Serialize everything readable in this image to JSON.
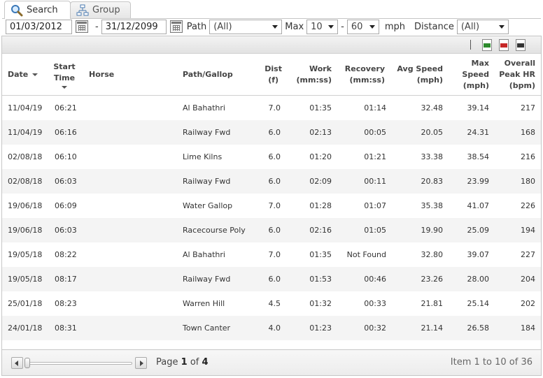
{
  "tabs": [
    {
      "label": "Search",
      "icon": "magnifier-icon",
      "active": true
    },
    {
      "label": "Group",
      "icon": "hierarchy-icon",
      "active": false
    }
  ],
  "filters": {
    "date_from": "01/03/2012",
    "date_sep": "-",
    "date_to": "31/12/2099",
    "path_label": "Path",
    "path_value": "(All)",
    "max_label": "Max",
    "speed_min": "10",
    "speed_sep": "-",
    "speed_max": "60",
    "speed_unit": "mph",
    "distance_label": "Distance",
    "distance_value": "(All)"
  },
  "toolbar": {
    "separator": "|",
    "exports": [
      "excel-export-icon",
      "pdf-export-icon",
      "csv-export-icon"
    ]
  },
  "columns": {
    "date": "Date",
    "start_time_1": "Start",
    "start_time_2": "Time",
    "horse": "Horse",
    "path": "Path/Gallop",
    "dist_1": "Dist",
    "dist_2": "(f)",
    "work_1": "Work",
    "work_2": "(mm:ss)",
    "recovery_1": "Recovery",
    "recovery_2": "(mm:ss)",
    "avg_1": "Avg Speed",
    "avg_2": "(mph)",
    "max_1": "Max",
    "max_2": "Speed",
    "max_3": "(mph)",
    "hr_1": "Overall",
    "hr_2": "Peak HR",
    "hr_3": "(bpm)"
  },
  "rows": [
    {
      "date": "11/04/19",
      "time": "06:21",
      "horse": "",
      "path": "Al Bahathri",
      "dist": "7.0",
      "work": "01:35",
      "recovery": "01:14",
      "avg": "32.48",
      "max": "39.14",
      "hr": "217"
    },
    {
      "date": "11/04/19",
      "time": "06:16",
      "horse": "",
      "path": "Railway Fwd",
      "dist": "6.0",
      "work": "02:13",
      "recovery": "00:05",
      "avg": "20.05",
      "max": "24.31",
      "hr": "168"
    },
    {
      "date": "02/08/18",
      "time": "06:10",
      "horse": "",
      "path": "Lime Kilns",
      "dist": "6.0",
      "work": "01:20",
      "recovery": "01:21",
      "avg": "33.38",
      "max": "38.54",
      "hr": "216"
    },
    {
      "date": "02/08/18",
      "time": "06:03",
      "horse": "",
      "path": "Railway Fwd",
      "dist": "6.0",
      "work": "02:09",
      "recovery": "00:11",
      "avg": "20.83",
      "max": "23.99",
      "hr": "180"
    },
    {
      "date": "19/06/18",
      "time": "06:09",
      "horse": "",
      "path": "Water Gallop",
      "dist": "7.0",
      "work": "01:28",
      "recovery": "01:07",
      "avg": "35.38",
      "max": "41.07",
      "hr": "226"
    },
    {
      "date": "19/06/18",
      "time": "06:03",
      "horse": "",
      "path": "Racecourse Poly",
      "dist": "6.0",
      "work": "02:16",
      "recovery": "01:05",
      "avg": "19.90",
      "max": "25.09",
      "hr": "194"
    },
    {
      "date": "19/05/18",
      "time": "08:22",
      "horse": "",
      "path": "Al Bahathri",
      "dist": "7.0",
      "work": "01:35",
      "recovery": "Not Found",
      "avg": "32.80",
      "max": "39.07",
      "hr": "227"
    },
    {
      "date": "19/05/18",
      "time": "08:17",
      "horse": "",
      "path": "Railway Fwd",
      "dist": "6.0",
      "work": "01:53",
      "recovery": "00:46",
      "avg": "23.26",
      "max": "28.00",
      "hr": "204"
    },
    {
      "date": "25/01/18",
      "time": "08:23",
      "horse": "",
      "path": "Warren Hill",
      "dist": "4.5",
      "work": "01:32",
      "recovery": "00:33",
      "avg": "21.81",
      "max": "25.14",
      "hr": "202"
    },
    {
      "date": "24/01/18",
      "time": "08:31",
      "horse": "",
      "path": "Town Canter",
      "dist": "4.0",
      "work": "01:23",
      "recovery": "00:32",
      "avg": "21.14",
      "max": "26.58",
      "hr": "184"
    }
  ],
  "pager": {
    "page_word": "Page",
    "current": "1",
    "of_word": "of",
    "total": "4",
    "item_summary": "Item 1 to 10 of 36"
  }
}
